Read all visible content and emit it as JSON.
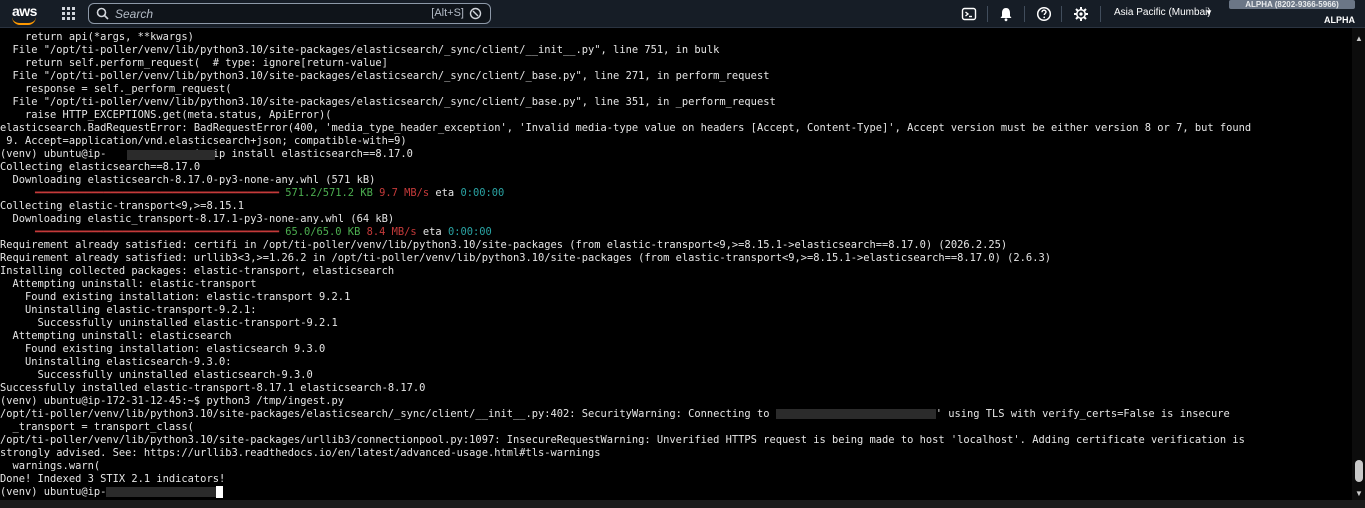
{
  "header": {
    "logo_text": "aws",
    "search_placeholder": "Search",
    "search_shortcut": "[Alt+S]",
    "region": "Asia Pacific (Mumbai)",
    "account": "ALPHA (8202-9366-5966)",
    "account_label": "ALPHA",
    "icons": [
      "grid-icon",
      "search-icon",
      "cloudshell-icon",
      "bell-icon",
      "help-icon",
      "gear-icon",
      "caret-down-icon"
    ]
  },
  "terminal": {
    "lines": [
      "    return api(*args, **kwargs)",
      "  File \"/opt/ti-poller/venv/lib/python3.10/site-packages/elasticsearch/_sync/client/__init__.py\", line 751, in bulk",
      "    return self.perform_request(  # type: ignore[return-value]",
      "  File \"/opt/ti-poller/venv/lib/python3.10/site-packages/elasticsearch/_sync/client/_base.py\", line 271, in perform_request",
      "    response = self._perform_request(",
      "  File \"/opt/ti-poller/venv/lib/python3.10/site-packages/elasticsearch/_sync/client/_base.py\", line 351, in _perform_request",
      "    raise HTTP_EXCEPTIONS.get(meta.status, ApiError)(",
      "elasticsearch.BadRequestError: BadRequestError(400, 'media_type_header_exception', 'Invalid media-type value on headers [Accept, Content-Type]', Accept version must be either version 8 or 7, but found",
      " 9. Accept=application/vnd.elasticsearch+json; compatible-with=9)",
      "(venv) ubuntu@ip-            :~$ pip install elasticsearch==8.17.0",
      "Collecting elasticsearch==8.17.0",
      "  Downloading elasticsearch-8.17.0-py3-none-any.whl (571 kB)",
      "",
      "Collecting elastic-transport<9,>=8.15.1",
      "  Downloading elastic_transport-8.17.1-py3-none-any.whl (64 kB)",
      "",
      "Requirement already satisfied: certifi in /opt/ti-poller/venv/lib/python3.10/site-packages (from elastic-transport<9,>=8.15.1->elasticsearch==8.17.0) (2026.2.25)",
      "Requirement already satisfied: urllib3<3,>=1.26.2 in /opt/ti-poller/venv/lib/python3.10/site-packages (from elastic-transport<9,>=8.15.1->elasticsearch==8.17.0) (2.6.3)",
      "Installing collected packages: elastic-transport, elasticsearch",
      "  Attempting uninstall: elastic-transport",
      "    Found existing installation: elastic-transport 9.2.1",
      "    Uninstalling elastic-transport-9.2.1:",
      "      Successfully uninstalled elastic-transport-9.2.1",
      "  Attempting uninstall: elasticsearch",
      "    Found existing installation: elasticsearch 9.3.0",
      "    Uninstalling elasticsearch-9.3.0:",
      "      Successfully uninstalled elasticsearch-9.3.0",
      "Successfully installed elastic-transport-8.17.1 elasticsearch-8.17.0",
      "(venv) ubuntu@ip-172-31-12-45:~$ python3 /tmp/ingest.py",
      "",
      "  _transport = transport_class(",
      "/opt/ti-poller/venv/lib/python3.10/site-packages/urllib3/connectionpool.py:1097: InsecureRequestWarning: Unverified HTTPS request is being made to host 'localhost'. Adding certificate verification is",
      "strongly advised. See: https://urllib3.readthedocs.io/en/latest/advanced-usage.html#tls-warnings",
      "  warnings.warn(",
      "Done! Indexed 3 STIX 2.1 indicators!",
      ""
    ],
    "progress1": {
      "bar": "━━━━━━━━━━━━━━━━━━━━━━━━━━━━━━━━━━━━━━━",
      "size": "571.2/571.2 KB",
      "speed": "9.7 MB/s",
      "eta_label": "eta",
      "eta": "0:00:00",
      "fraction": 1.0
    },
    "progress2": {
      "bar": "━━━━━━━━━━━━━━━━━━━━━━━━━━━━━━━━━━━━━━━",
      "size": "65.0/65.0 KB",
      "speed": "8.4 MB/s",
      "eta_label": "eta",
      "eta": "0:00:00",
      "fraction": 1.0
    },
    "security_warning_prefix": "/opt/ti-poller/venv/lib/python3.10/site-packages/elasticsearch/_sync/client/__init__.py:402: SecurityWarning: Connecting to ",
    "security_warning_suffix": "' using TLS with verify_certs=False is insecure",
    "final_prompt": "(venv) ubuntu@ip-"
  }
}
